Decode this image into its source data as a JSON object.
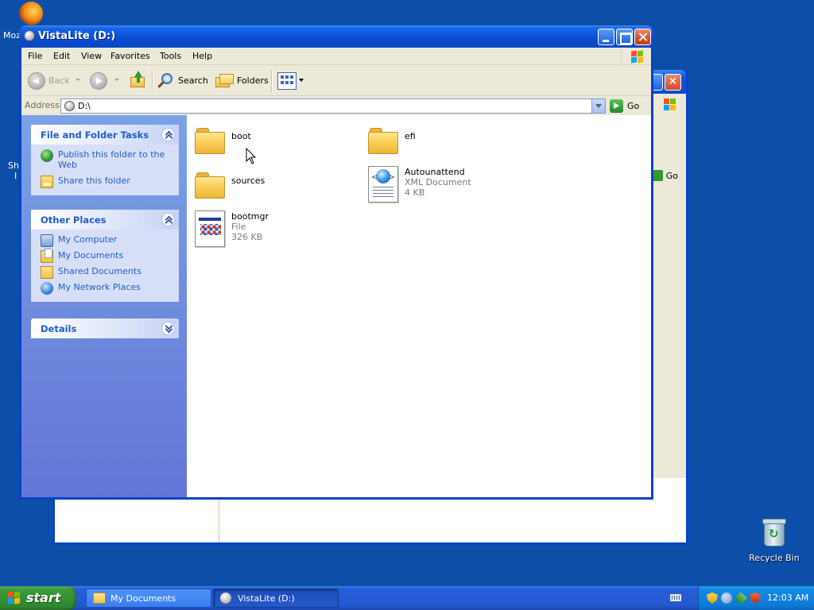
{
  "desktop": {
    "firefox_label": "Moz",
    "shortcut_label_line1": "Sh",
    "shortcut_label_line2": "I",
    "recycle_bin_label": "Recycle Bin"
  },
  "background_window": {
    "go_label": "Go"
  },
  "window": {
    "title": "VistaLite (D:)",
    "menu": [
      "File",
      "Edit",
      "View",
      "Favorites",
      "Tools",
      "Help"
    ],
    "toolbar": {
      "back_label": "Back",
      "search_label": "Search",
      "folders_label": "Folders"
    },
    "address": {
      "label": "Address",
      "value": "D:\\",
      "go_label": "Go"
    }
  },
  "task_pane": {
    "file_folder_tasks": {
      "title": "File and Folder Tasks",
      "links": [
        "Publish this folder to the Web",
        "Share this folder"
      ]
    },
    "other_places": {
      "title": "Other Places",
      "links": [
        "My Computer",
        "My Documents",
        "Shared Documents",
        "My Network Places"
      ]
    },
    "details": {
      "title": "Details"
    }
  },
  "files": [
    {
      "name": "boot",
      "type": "folder"
    },
    {
      "name": "efi",
      "type": "folder"
    },
    {
      "name": "sources",
      "type": "folder"
    },
    {
      "name": "Autounattend",
      "type": "xml",
      "kind": "XML Document",
      "size": "4 KB"
    },
    {
      "name": "bootmgr",
      "type": "file",
      "kind": "File",
      "size": "326 KB"
    }
  ],
  "taskbar": {
    "start_label": "start",
    "tasks": [
      {
        "label": "My Documents",
        "active": false
      },
      {
        "label": "VistaLite (D:)",
        "active": true
      }
    ],
    "clock": "12:03 AM"
  },
  "colors": {
    "desktop": "#0d4fa8",
    "titlebar": "#0a4bd0",
    "task_link": "#215dc6",
    "start_green": "#3c9a3c"
  }
}
